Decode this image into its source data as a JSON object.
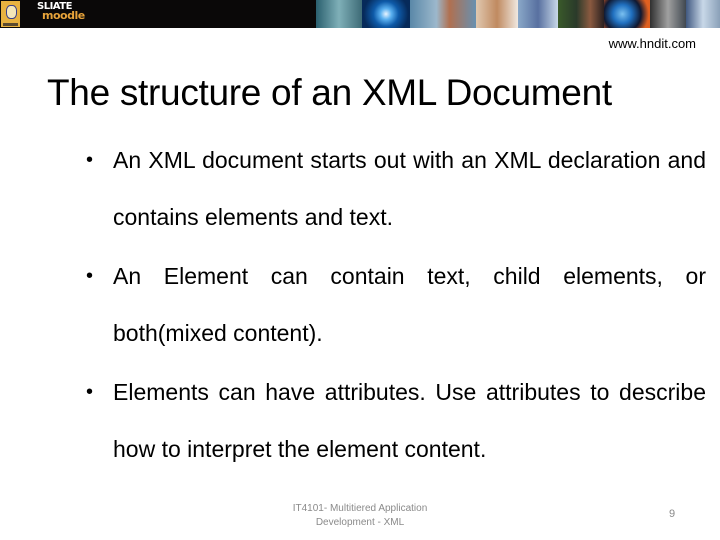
{
  "banner": {
    "logo_line1": "SLIATE",
    "logo_line2": "moodle",
    "brand_colors": {
      "background": "#0a0808",
      "accent": "#e7a33a",
      "badge": "#e8b240"
    },
    "photo_strip": [
      "robot-photo",
      "globe-eye-photo",
      "touchscreen-photo",
      "students-photo",
      "keyboard-photo",
      "classroom-photo",
      "earth-photo",
      "cyborg-photo",
      "eye-photo"
    ]
  },
  "header": {
    "website": "www.hndit.com"
  },
  "slide": {
    "title": "The structure of an XML Document",
    "bullets": [
      {
        "text": "An XML document starts out with an XML declaration and contains elements and text."
      },
      {
        "text": "An Element can contain text, child elements, or both(mixed content)."
      },
      {
        "text": "Elements can have attributes. Use attributes to describe how to interpret the element content."
      }
    ],
    "bullet_glyph": "•"
  },
  "footer": {
    "course_line1": "IT4101- Multitiered Application",
    "course_line2": "Development - XML",
    "page_number": "9"
  }
}
